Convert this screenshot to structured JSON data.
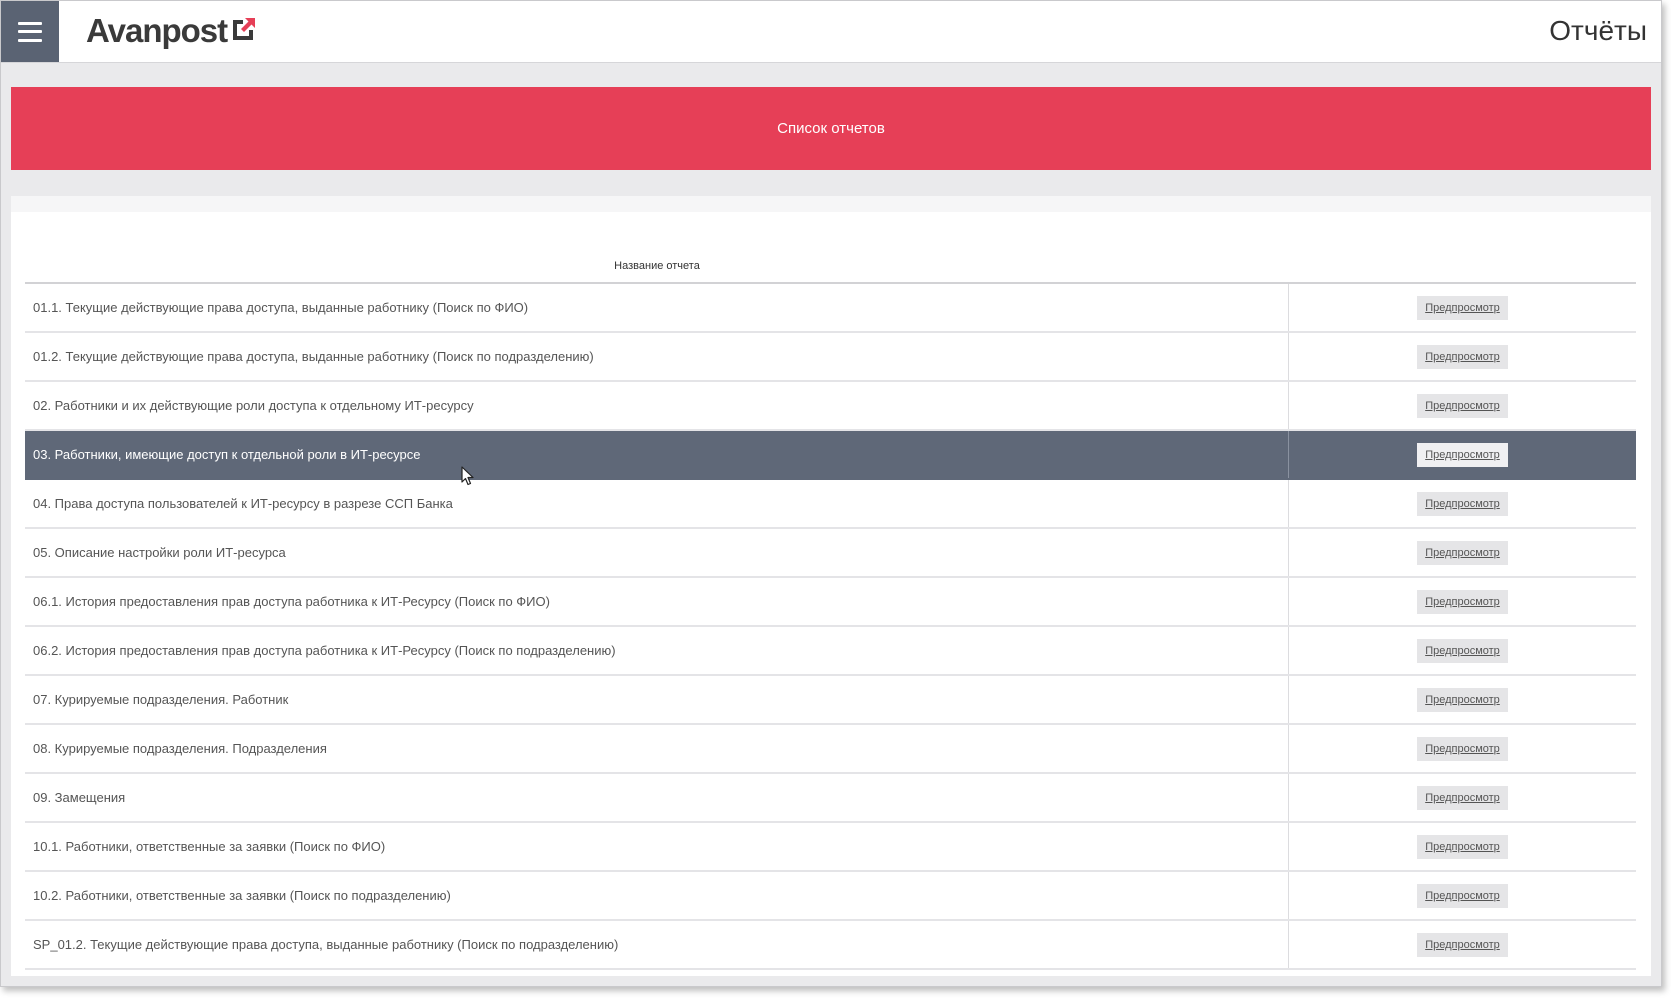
{
  "header": {
    "logo_text": "Avanpost",
    "page_title": "Отчёты"
  },
  "banner": {
    "title": "Список отчетов"
  },
  "table": {
    "column_name": "Название отчета",
    "preview_label": "Предпросмотр",
    "selected_index": 3,
    "rows": [
      {
        "name": "01.1. Текущие действующие права доступа, выданные работнику (Поиск по ФИО)"
      },
      {
        "name": "01.2. Текущие действующие права доступа, выданные работнику (Поиск по подразделению)"
      },
      {
        "name": "02. Работники и их действующие роли доступа к отдельному ИТ-ресурсу"
      },
      {
        "name": "03. Работники, имеющие доступ к отдельной роли в ИТ-ресурсе"
      },
      {
        "name": "04. Права доступа пользователей к ИТ-ресурсу в разрезе ССП Банка"
      },
      {
        "name": "05. Описание настройки роли ИТ-ресурса"
      },
      {
        "name": "06.1. История предоставления прав доступа работника к ИТ-Ресурсу (Поиск по ФИО)"
      },
      {
        "name": "06.2. История предоставления прав доступа работника к ИТ-Ресурсу (Поиск по подразделению)"
      },
      {
        "name": "07. Курируемые подразделения. Работник"
      },
      {
        "name": "08. Курируемые подразделения. Подразделения"
      },
      {
        "name": "09. Замещения"
      },
      {
        "name": "10.1. Работники, ответственные за заявки (Поиск по ФИО)"
      },
      {
        "name": "10.2. Работники, ответственные за заявки (Поиск по подразделению)"
      },
      {
        "name": "SP_01.2. Текущие действующие права доступа, выданные работнику (Поиск по подразделению)"
      }
    ]
  },
  "colors": {
    "banner": "#e63f57",
    "menu_button": "#5a6373",
    "selected_row": "#5f6878",
    "logo_accent": "#e63f57"
  },
  "icons": {
    "menu": "hamburger-icon",
    "logo_mark": "arrow-out-icon",
    "cursor": "mouse-pointer-icon"
  }
}
